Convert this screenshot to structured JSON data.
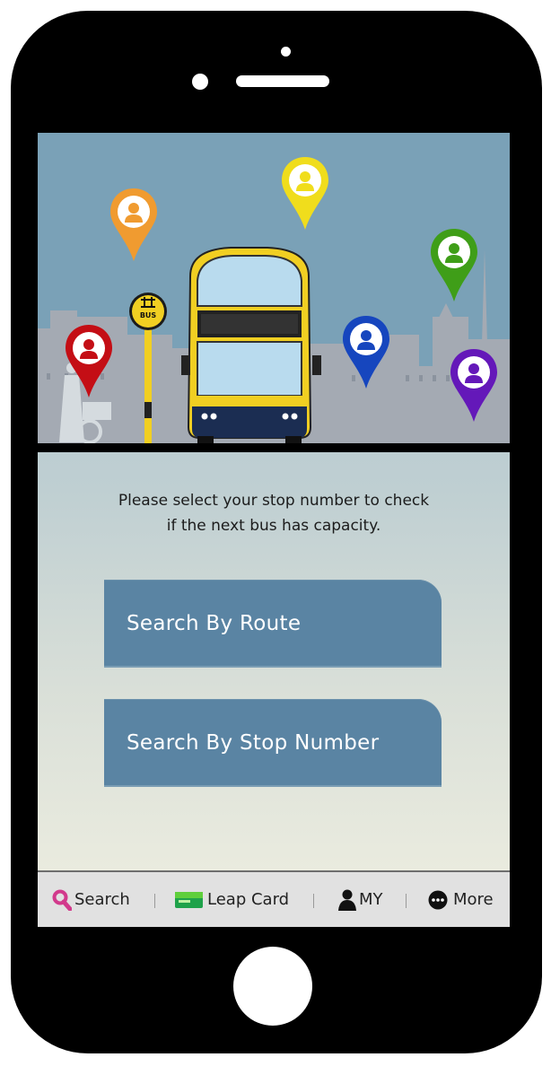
{
  "message": {
    "line1": "Please select your stop number to check",
    "line2": "if the next bus has capacity."
  },
  "buttons": {
    "route": "Search By Route",
    "stop": "Search By Stop Number"
  },
  "tabbar": {
    "search": "Search",
    "leap": "Leap Card",
    "my": "MY",
    "more": "More"
  },
  "bus_stop_sign": "BUS",
  "colors": {
    "button": "#5a84a3",
    "sky": "#7aa1b7",
    "skyline": "#a4aab3",
    "bus_yellow": "#f1cf22",
    "bus_navy": "#1b2d52",
    "pin_red": "#c40e15",
    "pin_orange": "#f09b30",
    "pin_yellow": "#f0dd1c",
    "pin_green": "#3f9e18",
    "pin_blue": "#1646be",
    "pin_purple": "#6418b9",
    "search_icon": "#d23a8c"
  },
  "icons": [
    "search-icon",
    "leap-card-icon",
    "person-icon",
    "more-icon",
    "location-pin-icon"
  ]
}
